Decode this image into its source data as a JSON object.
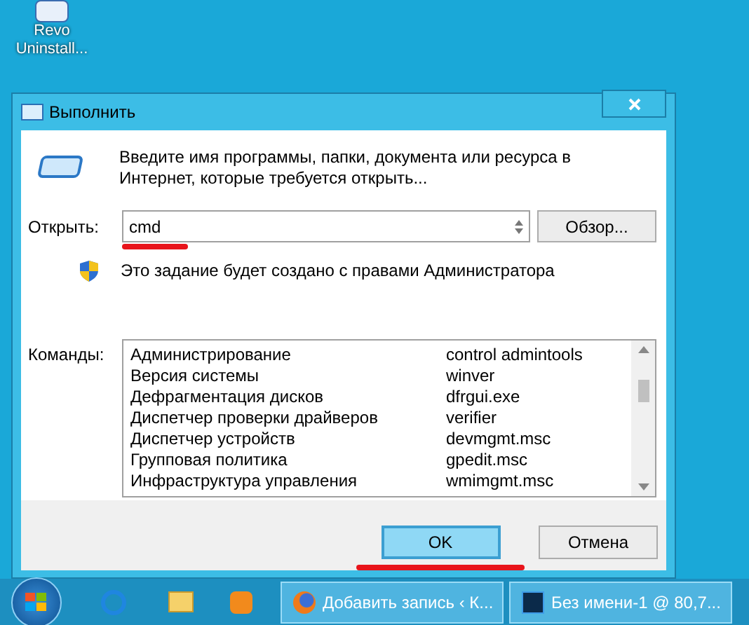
{
  "desktop_icons": [
    {
      "label": "Revo Uninstall..."
    }
  ],
  "dialog": {
    "title": "Выполнить",
    "description": "Введите имя программы, папки, документа или ресурса в Интернет, которые требуется открыть...",
    "open_label": "Открыть:",
    "open_value": "cmd",
    "browse_button": "Обзор...",
    "admin_note": "Это задание будет создано с правами Администратора",
    "commands_label": "Команды:",
    "commands": [
      {
        "name": "Администрирование",
        "command": "control admintools"
      },
      {
        "name": "Версия системы",
        "command": "winver"
      },
      {
        "name": "Дефрагментация дисков",
        "command": "dfrgui.exe"
      },
      {
        "name": "Диспетчер проверки драйверов",
        "command": "verifier"
      },
      {
        "name": "Диспетчер устройств",
        "command": "devmgmt.msc"
      },
      {
        "name": "Групповая политика",
        "command": "gpedit.msc"
      },
      {
        "name": "Инфраструктура управления",
        "command": "wmimgmt.msc"
      }
    ],
    "buttons": [
      {
        "label": "OK",
        "selected": true
      },
      {
        "label": "Отмена",
        "selected": false
      }
    ]
  },
  "taskbar": {
    "windows": [
      {
        "kind": "firefox",
        "label": "Добавить запись ‹ К..."
      },
      {
        "kind": "photoshop",
        "label": "Без имени-1 @ 80,7..."
      }
    ]
  }
}
